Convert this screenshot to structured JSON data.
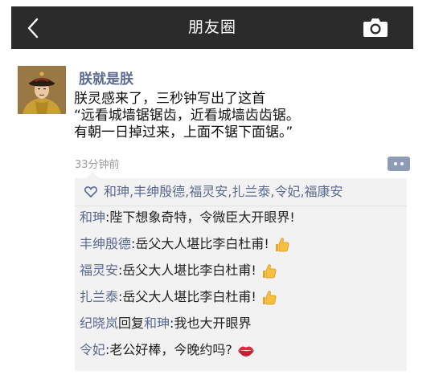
{
  "header": {
    "title": "朋友圈",
    "back_icon": "chevron-left-icon",
    "camera_icon": "camera-icon"
  },
  "post": {
    "author": "朕就是朕",
    "avatar": "qing-emperor-portrait",
    "lines": [
      "朕灵感来了，三秒钟写出了这首",
      "“远看城墙锯锯齿，近看城墙齿齿锯。",
      "有朝一日掉过来，上面不锯下面锯。”"
    ],
    "time": "33分钟前"
  },
  "likes": {
    "icon": "heart-outline-icon",
    "names": [
      "和珅",
      "丰绅殷德",
      "福灵安",
      "扎兰泰",
      "令妃",
      "福康安"
    ],
    "separator": ","
  },
  "comments": [
    {
      "author": "和珅",
      "text": ":陛下想象奇特，令微臣大开眼界!"
    },
    {
      "author": "丰绅殷德",
      "text": ":岳父大人堪比李白杜甫!",
      "emoji": "thumbs-up-icon"
    },
    {
      "author": "福灵安",
      "text": ":岳父大人堪比李白杜甫!",
      "emoji": "thumbs-up-icon"
    },
    {
      "author": "扎兰泰",
      "text": ":岳父大人堪比李白杜甫!",
      "emoji": "thumbs-up-icon"
    },
    {
      "author": "纪晓岚",
      "reply_word": "回复",
      "reply_to": "和珅",
      "text": ":我也大开眼界"
    },
    {
      "author": "令妃",
      "text": ":老公好棒，今晚约吗?",
      "emoji": "lips-icon"
    }
  ],
  "colors": {
    "topbar": "#2b2b2b",
    "name_link": "#5b6a91",
    "panel_bg": "#f2f2f2",
    "time": "#9b9b9b"
  }
}
